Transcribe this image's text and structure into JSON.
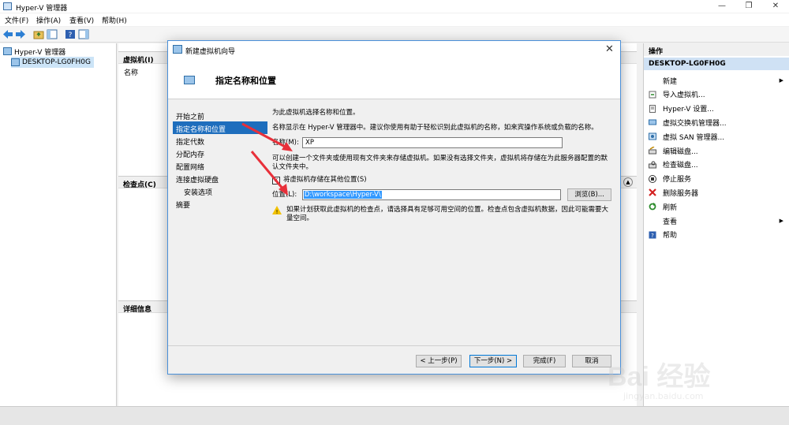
{
  "window": {
    "title": "Hyper-V 管理器"
  },
  "menu": {
    "items": [
      "文件(F)",
      "操作(A)",
      "查看(V)",
      "帮助(H)"
    ]
  },
  "tree": {
    "root": "Hyper-V 管理器",
    "host": "DESKTOP-LG0FH0G"
  },
  "center": {
    "vm_section": "虚拟机(I)",
    "vm_col_name": "名称",
    "checkpoints_section": "检查点(C)",
    "details_section": "详细信息"
  },
  "actions": {
    "header": "操作",
    "host": "DESKTOP-LG0FH0G",
    "items": [
      {
        "label": "新建",
        "icon": "none",
        "submenu": true
      },
      {
        "label": "导入虚拟机...",
        "icon": "import-icon",
        "submenu": false
      },
      {
        "label": "Hyper-V 设置...",
        "icon": "settings-page-icon",
        "submenu": false
      },
      {
        "label": "虚拟交换机管理器...",
        "icon": "switch-icon",
        "submenu": false
      },
      {
        "label": "虚拟 SAN 管理器...",
        "icon": "san-icon",
        "submenu": false
      },
      {
        "label": "编辑磁盘...",
        "icon": "edit-disk-icon",
        "submenu": false
      },
      {
        "label": "检查磁盘...",
        "icon": "inspect-disk-icon",
        "submenu": false
      },
      {
        "label": "停止服务",
        "icon": "stop-icon",
        "submenu": false
      },
      {
        "label": "删除服务器",
        "icon": "delete-icon",
        "submenu": false
      },
      {
        "label": "刷新",
        "icon": "refresh-icon",
        "submenu": false
      },
      {
        "label": "查看",
        "icon": "none",
        "submenu": true
      },
      {
        "label": "帮助",
        "icon": "help-icon",
        "submenu": false
      }
    ]
  },
  "dialog": {
    "title": "新建虚拟机向导",
    "heading": "指定名称和位置",
    "steps": [
      {
        "label": "开始之前",
        "sub": false,
        "active": false
      },
      {
        "label": "指定名称和位置",
        "sub": false,
        "active": true
      },
      {
        "label": "指定代数",
        "sub": false,
        "active": false
      },
      {
        "label": "分配内存",
        "sub": false,
        "active": false
      },
      {
        "label": "配置网络",
        "sub": false,
        "active": false
      },
      {
        "label": "连接虚拟硬盘",
        "sub": false,
        "active": false
      },
      {
        "label": "安装选项",
        "sub": true,
        "active": false
      },
      {
        "label": "摘要",
        "sub": false,
        "active": false
      }
    ],
    "intro": "为此虚拟机选择名称和位置。",
    "name_hint": "名称显示在 Hyper-V 管理器中。建议你使用有助于轻松识别此虚拟机的名称，如来宾操作系统或负载的名称。",
    "name_label": "名称(M):",
    "name_value": "XP",
    "folder_hint": "可以创建一个文件夹或使用现有文件夹来存储虚拟机。如果没有选择文件夹，虚拟机将存储在为此服务器配置的默认文件夹中。",
    "store_checkbox_label": "将虚拟机存储在其他位置(S)",
    "store_checked": true,
    "location_label": "位置(L):",
    "location_value": "D:\\workspace\\Hyper-V\\",
    "browse_button": "浏览(B)...",
    "warning": "如果计划获取此虚拟机的检查点，请选择具有足够可用空间的位置。检查点包含虚拟机数据，因此可能需要大量空间。",
    "buttons": {
      "prev": "< 上一步(P)",
      "next": "下一步(N) >",
      "finish": "完成(F)",
      "cancel": "取消"
    }
  },
  "watermark": {
    "brand": "Bai 经验",
    "url": "jingyan.baidu.com"
  },
  "colors": {
    "accent": "#1e6ebd",
    "annotation_arrow": "#e8303a"
  }
}
